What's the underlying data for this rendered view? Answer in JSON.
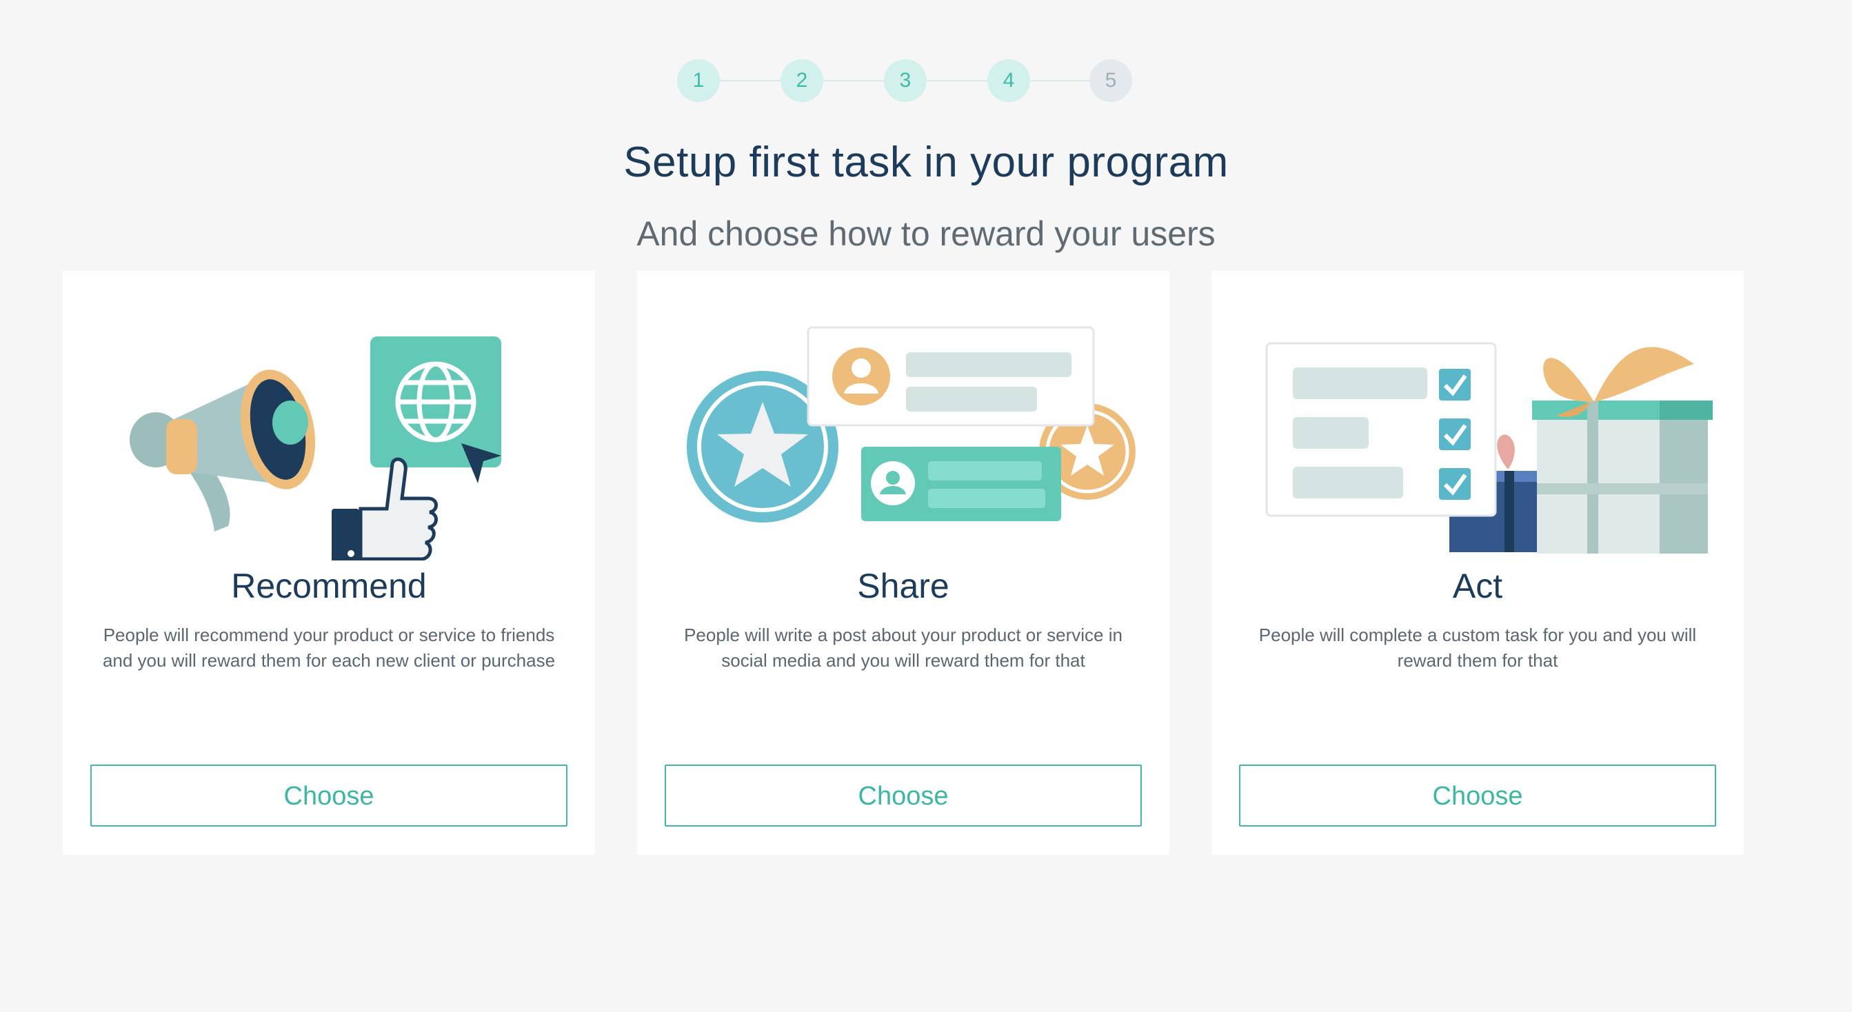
{
  "stepper": {
    "steps": [
      {
        "label": "1",
        "active": true
      },
      {
        "label": "2",
        "active": true
      },
      {
        "label": "3",
        "active": true
      },
      {
        "label": "4",
        "active": true
      },
      {
        "label": "5",
        "active": false
      }
    ]
  },
  "header": {
    "title": "Setup first task in your program",
    "subtitle": "And choose how to reward your users"
  },
  "cards": [
    {
      "title": "Recommend",
      "description": "People will recommend your product or service to friends and you will reward them for each new client or purchase",
      "button": "Choose",
      "illustration": "megaphone-thumbs-up-globe"
    },
    {
      "title": "Share",
      "description": "People will write a post about your product or service in social media and you will reward them for that",
      "button": "Choose",
      "illustration": "star-badges-profile-cards"
    },
    {
      "title": "Act",
      "description": "People will complete a custom task for you and you will reward them for that",
      "button": "Choose",
      "illustration": "checklist-gift-boxes"
    }
  ],
  "colors": {
    "background": "#f6f6f6",
    "accent": "#45b9a6",
    "title": "#1d3b5a",
    "text": "#5c6670"
  }
}
